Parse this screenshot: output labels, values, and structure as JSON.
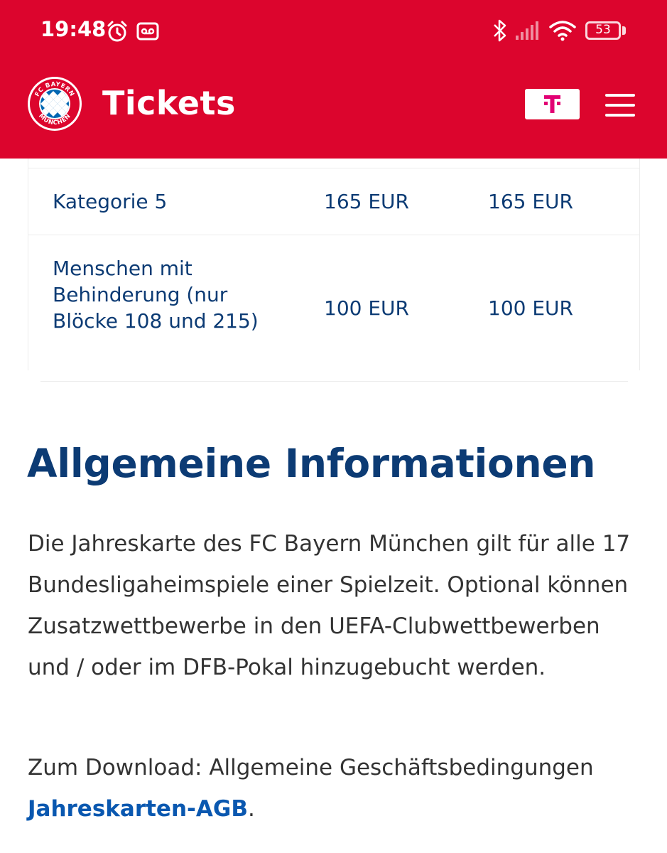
{
  "status_bar": {
    "time": "19:48",
    "battery": "53",
    "icons": [
      "alarm-icon",
      "voicemail-icon",
      "bluetooth-icon",
      "signal-icon",
      "wifi-icon",
      "battery-icon"
    ]
  },
  "header": {
    "logo_alt": "FC Bayern München",
    "logo_text_top": "FC BAYERN",
    "logo_text_bottom": "MÜNCHEN",
    "title": "Tickets",
    "sponsor_glyph": "T",
    "menu_icon": "hamburger-menu-icon"
  },
  "price_table": {
    "rows": [
      {
        "category": "Kategorie 5",
        "price_1": "165 EUR",
        "price_2": "165 EUR"
      },
      {
        "category": "Menschen mit Behinderung (nur Blöcke 108 und 215)",
        "price_1": "100 EUR",
        "price_2": "100 EUR"
      }
    ]
  },
  "info": {
    "title": "Allgemeine Informationen",
    "paragraph": "Die Jahreskarte des FC Bayern München gilt für alle 17 Bundesligaheimspiele einer Spielzeit. Optional können Zusatzwettbewerbe in den UEFA-Clubwettbewerben und / oder im DFB-Pokal hinzugebucht werden.",
    "download_text": "Zum Download: Allgemeine Geschäftsbedingungen",
    "download_link": "Jahreskarten-AGB",
    "download_suffix": "."
  },
  "colors": {
    "brand_red": "#dc052d",
    "navy": "#0c3b74",
    "link_blue": "#0a58b0",
    "telekom_magenta": "#e20074"
  }
}
